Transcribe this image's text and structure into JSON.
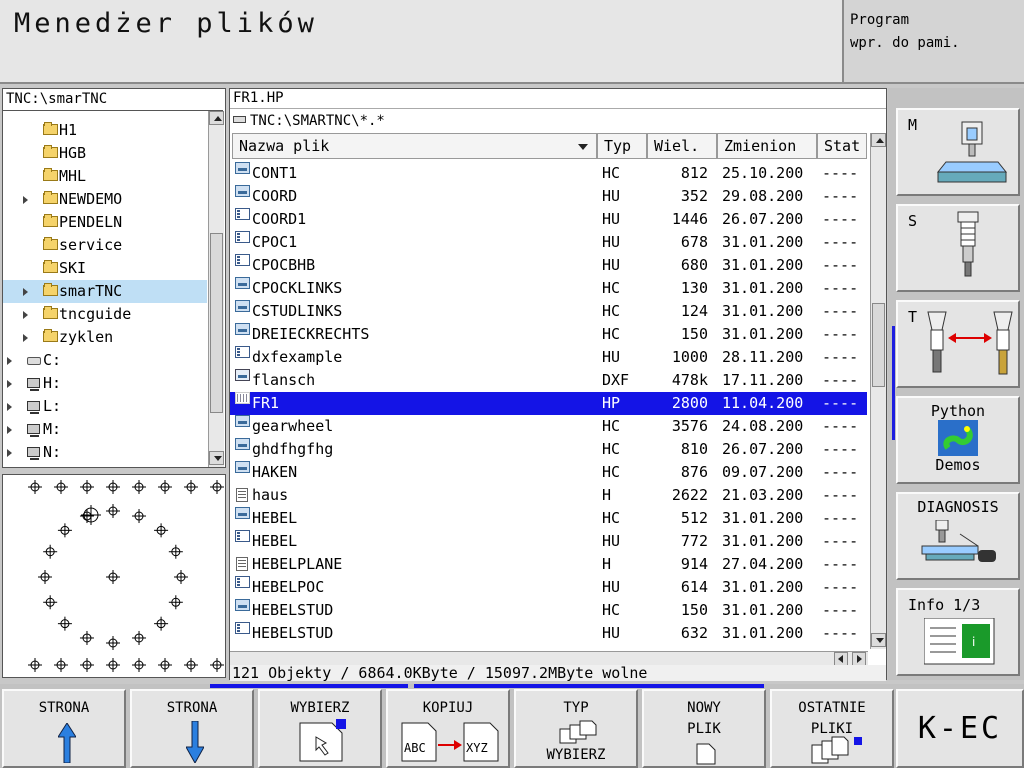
{
  "header": {
    "title": "Menedżer plików",
    "mode_line1": "Program",
    "mode_line2": "wpr. do pami."
  },
  "dir_panel": {
    "path": "TNC:\\smarTNC",
    "items": [
      {
        "label": "H1",
        "type": "folder",
        "level": 2,
        "expandable": false,
        "selected": false
      },
      {
        "label": "HGB",
        "type": "folder",
        "level": 2,
        "expandable": false,
        "selected": false
      },
      {
        "label": "MHL",
        "type": "folder",
        "level": 2,
        "expandable": false,
        "selected": false
      },
      {
        "label": "NEWDEMO",
        "type": "folder",
        "level": 2,
        "expandable": true,
        "selected": false
      },
      {
        "label": "PENDELN",
        "type": "folder",
        "level": 2,
        "expandable": false,
        "selected": false
      },
      {
        "label": "service",
        "type": "folder",
        "level": 2,
        "expandable": false,
        "selected": false
      },
      {
        "label": "SKI",
        "type": "folder",
        "level": 2,
        "expandable": false,
        "selected": false
      },
      {
        "label": "smarTNC",
        "type": "folder",
        "level": 2,
        "expandable": true,
        "selected": true
      },
      {
        "label": "tncguide",
        "type": "folder",
        "level": 2,
        "expandable": true,
        "selected": false
      },
      {
        "label": "zyklen",
        "type": "folder",
        "level": 2,
        "expandable": true,
        "selected": false
      },
      {
        "label": "C:",
        "type": "drive",
        "level": 1,
        "expandable": true,
        "selected": false
      },
      {
        "label": "H:",
        "type": "network",
        "level": 1,
        "expandable": true,
        "selected": false
      },
      {
        "label": "L:",
        "type": "network",
        "level": 1,
        "expandable": true,
        "selected": false
      },
      {
        "label": "M:",
        "type": "network",
        "level": 1,
        "expandable": true,
        "selected": false
      },
      {
        "label": "N:",
        "type": "network",
        "level": 1,
        "expandable": true,
        "selected": false
      }
    ]
  },
  "file_panel": {
    "selected_file": "FR1.HP",
    "filter": "TNC:\\SMARTNC\\*.*",
    "columns": [
      "Nazwa plik",
      "Typ",
      "Wiel.",
      "Zmienion",
      "Stat"
    ],
    "files": [
      {
        "name": "CONT1",
        "type": "HC",
        "size": "812",
        "modified": "25.10.200",
        "status": "----",
        "icon": "hc",
        "selected": false
      },
      {
        "name": "COORD",
        "type": "HU",
        "size": "352",
        "modified": "29.08.200",
        "status": "----",
        "icon": "hc",
        "selected": false
      },
      {
        "name": "COORD1",
        "type": "HU",
        "size": "1446",
        "modified": "26.07.200",
        "status": "----",
        "icon": "hu",
        "selected": false
      },
      {
        "name": "CPOC1",
        "type": "HU",
        "size": "678",
        "modified": "31.01.200",
        "status": "----",
        "icon": "hu",
        "selected": false
      },
      {
        "name": "CPOCBHB",
        "type": "HU",
        "size": "680",
        "modified": "31.01.200",
        "status": "----",
        "icon": "hu",
        "selected": false
      },
      {
        "name": "CPOCKLINKS",
        "type": "HC",
        "size": "130",
        "modified": "31.01.200",
        "status": "----",
        "icon": "hc",
        "selected": false
      },
      {
        "name": "CSTUDLINKS",
        "type": "HC",
        "size": "124",
        "modified": "31.01.200",
        "status": "----",
        "icon": "hc",
        "selected": false
      },
      {
        "name": "DREIECKRECHTS",
        "type": "HC",
        "size": "150",
        "modified": "31.01.200",
        "status": "----",
        "icon": "hc",
        "selected": false
      },
      {
        "name": "dxfexample",
        "type": "HU",
        "size": "1000",
        "modified": "28.11.200",
        "status": "----",
        "icon": "hu",
        "selected": false
      },
      {
        "name": "flansch",
        "type": "DXF",
        "size": "478k",
        "modified": "17.11.200",
        "status": "----",
        "icon": "dxf",
        "selected": false
      },
      {
        "name": "FR1",
        "type": "HP",
        "size": "2800",
        "modified": "11.04.200",
        "status": "----",
        "icon": "hp",
        "selected": true
      },
      {
        "name": "gearwheel",
        "type": "HC",
        "size": "3576",
        "modified": "24.08.200",
        "status": "----",
        "icon": "hc",
        "selected": false
      },
      {
        "name": "ghdfhgfhg",
        "type": "HC",
        "size": "810",
        "modified": "26.07.200",
        "status": "----",
        "icon": "hc",
        "selected": false
      },
      {
        "name": "HAKEN",
        "type": "HC",
        "size": "876",
        "modified": "09.07.200",
        "status": "----",
        "icon": "hc",
        "selected": false
      },
      {
        "name": "haus",
        "type": "H",
        "size": "2622",
        "modified": "21.03.200",
        "status": "----",
        "icon": "h",
        "selected": false
      },
      {
        "name": "HEBEL",
        "type": "HC",
        "size": "512",
        "modified": "31.01.200",
        "status": "----",
        "icon": "hc",
        "selected": false
      },
      {
        "name": "HEBEL",
        "type": "HU",
        "size": "772",
        "modified": "31.01.200",
        "status": "----",
        "icon": "hu",
        "selected": false
      },
      {
        "name": "HEBELPLANE",
        "type": "H",
        "size": "914",
        "modified": "27.04.200",
        "status": "----",
        "icon": "h",
        "selected": false
      },
      {
        "name": "HEBELPOC",
        "type": "HU",
        "size": "614",
        "modified": "31.01.200",
        "status": "----",
        "icon": "hu",
        "selected": false
      },
      {
        "name": "HEBELSTUD",
        "type": "HC",
        "size": "150",
        "modified": "31.01.200",
        "status": "----",
        "icon": "hc",
        "selected": false
      },
      {
        "name": "HEBELSTUD",
        "type": "HU",
        "size": "632",
        "modified": "31.01.200",
        "status": "----",
        "icon": "hu",
        "selected": false
      }
    ],
    "status": "121 Objekty / 6864.0KByte / 15097.2MByte wolne"
  },
  "side_softkeys": [
    {
      "label": "M",
      "icon": "spindle-machine-icon"
    },
    {
      "label": "S",
      "icon": "spindle-tool-icon"
    },
    {
      "label": "T",
      "icon": "tool-change-icon"
    },
    {
      "label": "Python",
      "label2": "Demos",
      "icon": "python-icon"
    },
    {
      "label": "DIAGNOSIS",
      "icon": "diagnosis-icon"
    },
    {
      "label": "Info 1/3",
      "icon": "info-icon"
    }
  ],
  "softkeys": [
    {
      "line1": "STRONA",
      "icon": "arrow-up-icon"
    },
    {
      "line1": "STRONA",
      "icon": "arrow-down-icon"
    },
    {
      "line1": "WYBIERZ",
      "icon": "select-file-icon"
    },
    {
      "line1": "KOPIUJ",
      "abc": "ABC",
      "xyz": "XYZ",
      "icon": "copy-icon"
    },
    {
      "line1": "TYP",
      "line3": "WYBIERZ",
      "icon": "file-type-icon"
    },
    {
      "line1": "NOWY",
      "line2": "PLIK",
      "icon": "new-file-icon"
    },
    {
      "line1": "OSTATNIE",
      "line2": "PLIKI",
      "icon": "recent-files-icon"
    }
  ],
  "end_key": "K-EC",
  "colors": {
    "selection": "#1414e6",
    "tree_selection": "#bfdff5",
    "folder": "#f5d36a"
  }
}
